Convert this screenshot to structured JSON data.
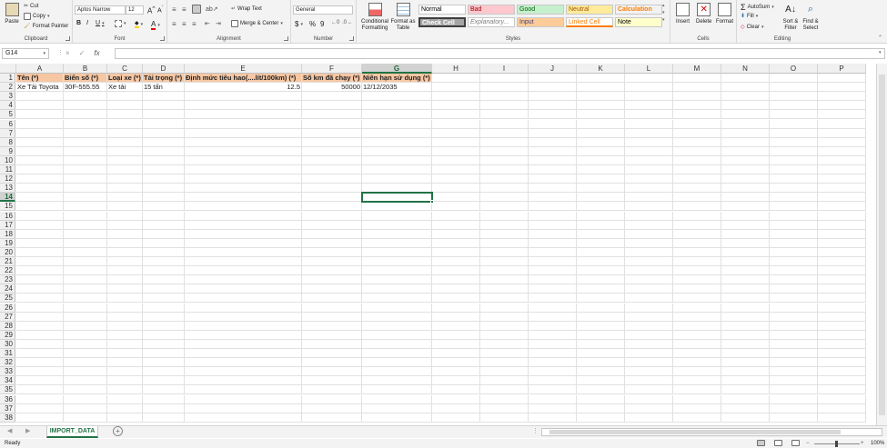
{
  "ribbon": {
    "clipboard": {
      "paste": "Paste",
      "cut": "Cut",
      "copy": "Copy",
      "format_painter": "Format Painter",
      "label": "Clipboard"
    },
    "font": {
      "name": "Aptos Narrow",
      "size": "12",
      "bold": "B",
      "italic": "I",
      "underline": "U",
      "font_color_glyph": "A",
      "label": "Font"
    },
    "alignment": {
      "wrap_text": "Wrap Text",
      "merge_center": "Merge & Center",
      "label": "Alignment"
    },
    "number": {
      "format": "General",
      "currency": "$",
      "percent": "%",
      "comma": "9",
      "label": "Number"
    },
    "styles": {
      "conditional": "Conditional Formatting",
      "format_table": "Format as Table",
      "cells": [
        {
          "label": "Normal",
          "bg": "#ffffff",
          "color": "#000000"
        },
        {
          "label": "Bad",
          "bg": "#ffc7ce",
          "color": "#9c0006"
        },
        {
          "label": "Good",
          "bg": "#c6efce",
          "color": "#006100"
        },
        {
          "label": "Neutral",
          "bg": "#ffeb9c",
          "color": "#9c5700"
        },
        {
          "label": "Calculation",
          "bg": "#f2f2f2",
          "color": "#fa7d00"
        },
        {
          "label": "Check Cell",
          "bg": "#a5a5a5",
          "color": "#ffffff"
        },
        {
          "label": "Explanatory...",
          "bg": "#ffffff",
          "color": "#7f7f7f"
        },
        {
          "label": "Input",
          "bg": "#ffcc99",
          "color": "#3f3f76"
        },
        {
          "label": "Linked Cell",
          "bg": "#ffffff",
          "color": "#fa7d00"
        },
        {
          "label": "Note",
          "bg": "#ffffcc",
          "color": "#000000"
        }
      ],
      "label": "Styles"
    },
    "cells": {
      "insert": "Insert",
      "delete": "Delete",
      "format": "Format",
      "label": "Cells"
    },
    "editing": {
      "autosum": "AutoSum",
      "fill": "Fill",
      "clear": "Clear",
      "sort_filter": "Sort & Filter",
      "find_select": "Find & Select",
      "label": "Editing"
    }
  },
  "formula_bar": {
    "name_box": "G14",
    "fx": "fx",
    "cancel": "×",
    "enter": "✓",
    "content": ""
  },
  "columns": [
    "A",
    "B",
    "C",
    "D",
    "E",
    "F",
    "G",
    "H",
    "I",
    "J",
    "K",
    "L",
    "M",
    "N",
    "O",
    "P"
  ],
  "rows": [
    "1",
    "2",
    "3",
    "4",
    "5",
    "6",
    "7",
    "8",
    "9",
    "10",
    "11",
    "12",
    "13",
    "14",
    "15",
    "16",
    "17",
    "18",
    "19",
    "20",
    "21",
    "22",
    "23",
    "24",
    "25",
    "26",
    "27",
    "28",
    "29",
    "30",
    "31",
    "32",
    "33",
    "34",
    "35",
    "36",
    "37",
    "38"
  ],
  "sheet": {
    "headers": [
      "Tên (*)",
      "Biển số (*)",
      "Loại xe (*)",
      "Tải trọng (*)",
      "Định mức tiêu hao(....lít/100km) (*)",
      "Số km đã chạy (*)",
      "Niên hạn sử dụng (*)"
    ],
    "row2": [
      "Xe Tải Toyota",
      "30F-555.55",
      "Xe tải",
      "15 tấn",
      "12.5",
      "50000",
      "12/12/2035"
    ],
    "header_fill": "#f7c7a3",
    "selected_cell": "G14"
  },
  "tabs": {
    "active": "IMPORT_DATA",
    "add": "+"
  },
  "status": {
    "text": "Ready",
    "zoom": "100%"
  }
}
